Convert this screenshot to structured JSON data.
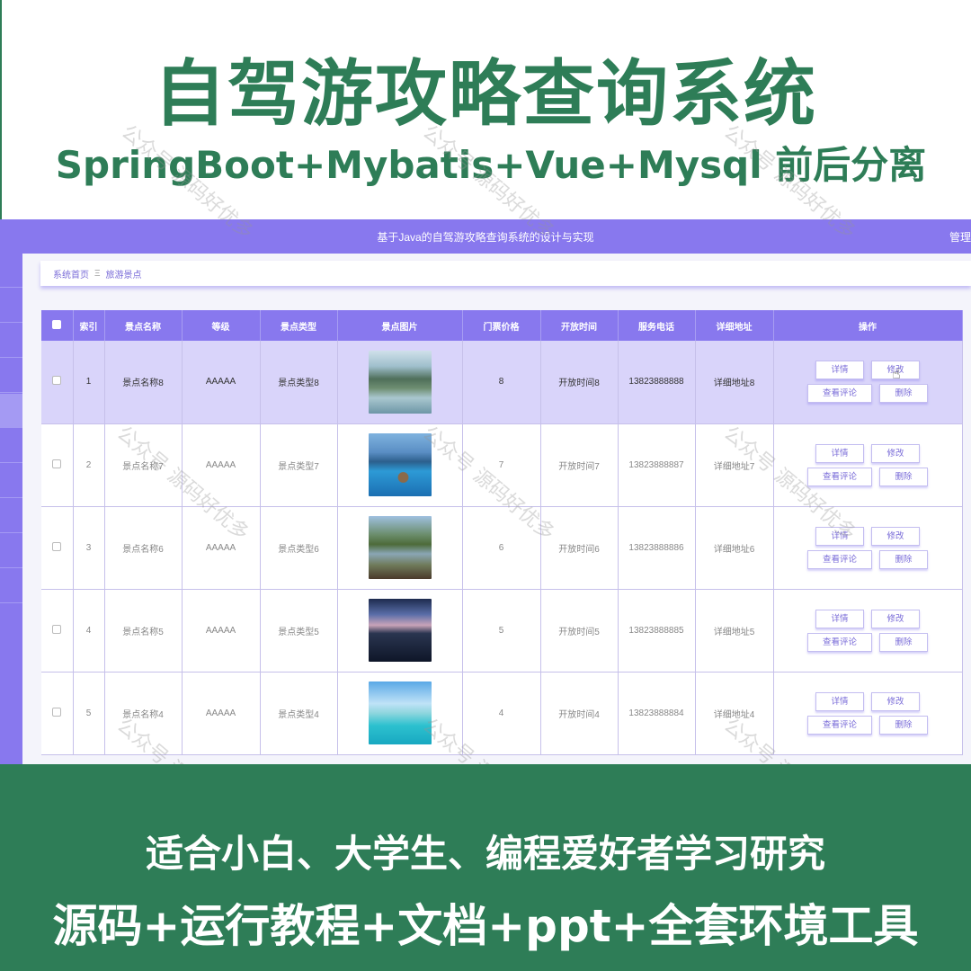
{
  "promo": {
    "title": "自驾游攻略查询系统",
    "subtitle": "SpringBoot+Mybatis+Vue+Mysql 前后分离",
    "footer_line1": "适合小白、大学生、编程爱好者学习研究",
    "footer_line2": "源码+运行教程+文档+ppt+全套环境工具",
    "watermark": "公众号 源码好优多",
    "colors": {
      "green": "#2e7d57",
      "purple": "#8878ee",
      "selected_row": "#d9d4fa"
    }
  },
  "app": {
    "title": "基于Java的自驾游攻略查询系统的设计与实现",
    "admin_link": "管理",
    "breadcrumb": {
      "home": "系统首页",
      "separator": "Ξ",
      "current": "旅游景点"
    },
    "table": {
      "headers": [
        "索引",
        "景点名称",
        "等级",
        "景点类型",
        "景点图片",
        "门票价格",
        "开放时间",
        "服务电话",
        "详细地址",
        "操作"
      ],
      "actions": {
        "detail": "详情",
        "edit": "修改",
        "comments": "查看评论",
        "delete": "删除"
      },
      "rows": [
        {
          "index": "1",
          "name": "景点名称8",
          "level": "AAAAA",
          "type": "景点类型8",
          "image": "karst-mountains-river",
          "price": "8",
          "open_time": "开放时间8",
          "phone": "13823888888",
          "address": "详细地址8",
          "selected": true
        },
        {
          "index": "2",
          "name": "景点名称7",
          "level": "AAAAA",
          "type": "景点类型7",
          "image": "lake-island",
          "price": "7",
          "open_time": "开放时间7",
          "phone": "13823888887",
          "address": "详细地址7",
          "selected": false
        },
        {
          "index": "3",
          "name": "景点名称6",
          "level": "AAAAA",
          "type": "景点类型6",
          "image": "mountain-lake-boats",
          "price": "6",
          "open_time": "开放时间6",
          "phone": "13823888886",
          "address": "详细地址6",
          "selected": false
        },
        {
          "index": "4",
          "name": "景点名称5",
          "level": "AAAAA",
          "type": "景点类型5",
          "image": "dusk-lake",
          "price": "5",
          "open_time": "开放时间5",
          "phone": "13823888885",
          "address": "详细地址5",
          "selected": false
        },
        {
          "index": "5",
          "name": "景点名称4",
          "level": "AAAAA",
          "type": "景点类型4",
          "image": "tropical-beach",
          "price": "4",
          "open_time": "开放时间4",
          "phone": "13823888884",
          "address": "详细地址4",
          "selected": false
        }
      ]
    }
  }
}
